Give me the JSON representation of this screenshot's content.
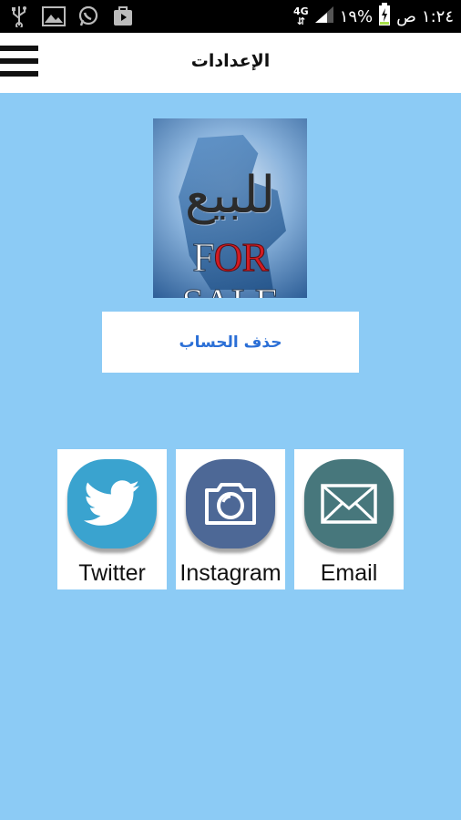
{
  "status_bar": {
    "time": "١:٢٤",
    "ampm": "ص",
    "battery": "١٩%",
    "network": "4G",
    "icons": [
      "usb-icon",
      "image-icon",
      "whatsapp-icon",
      "play-store-icon"
    ]
  },
  "app_bar": {
    "title": "الإعدادات",
    "menu_icon": "hamburger-menu-icon"
  },
  "logo": {
    "arabic_text": "للبيع",
    "english_text_part1": "F",
    "english_text_red": "OR",
    "english_text_part2": " SALE",
    "accent_color": "#d11c23"
  },
  "delete_account": {
    "label": "حذف الحساب"
  },
  "social": [
    {
      "label": "Twitter",
      "icon": "twitter-bird-icon",
      "color": "#3aa3cf"
    },
    {
      "label": "Instagram",
      "icon": "camera-icon",
      "color": "#4d6896"
    },
    {
      "label": "Email",
      "icon": "envelope-icon",
      "color": "#47777c"
    }
  ],
  "colors": {
    "background": "#8ccbf5",
    "link": "#2b6fd6"
  }
}
